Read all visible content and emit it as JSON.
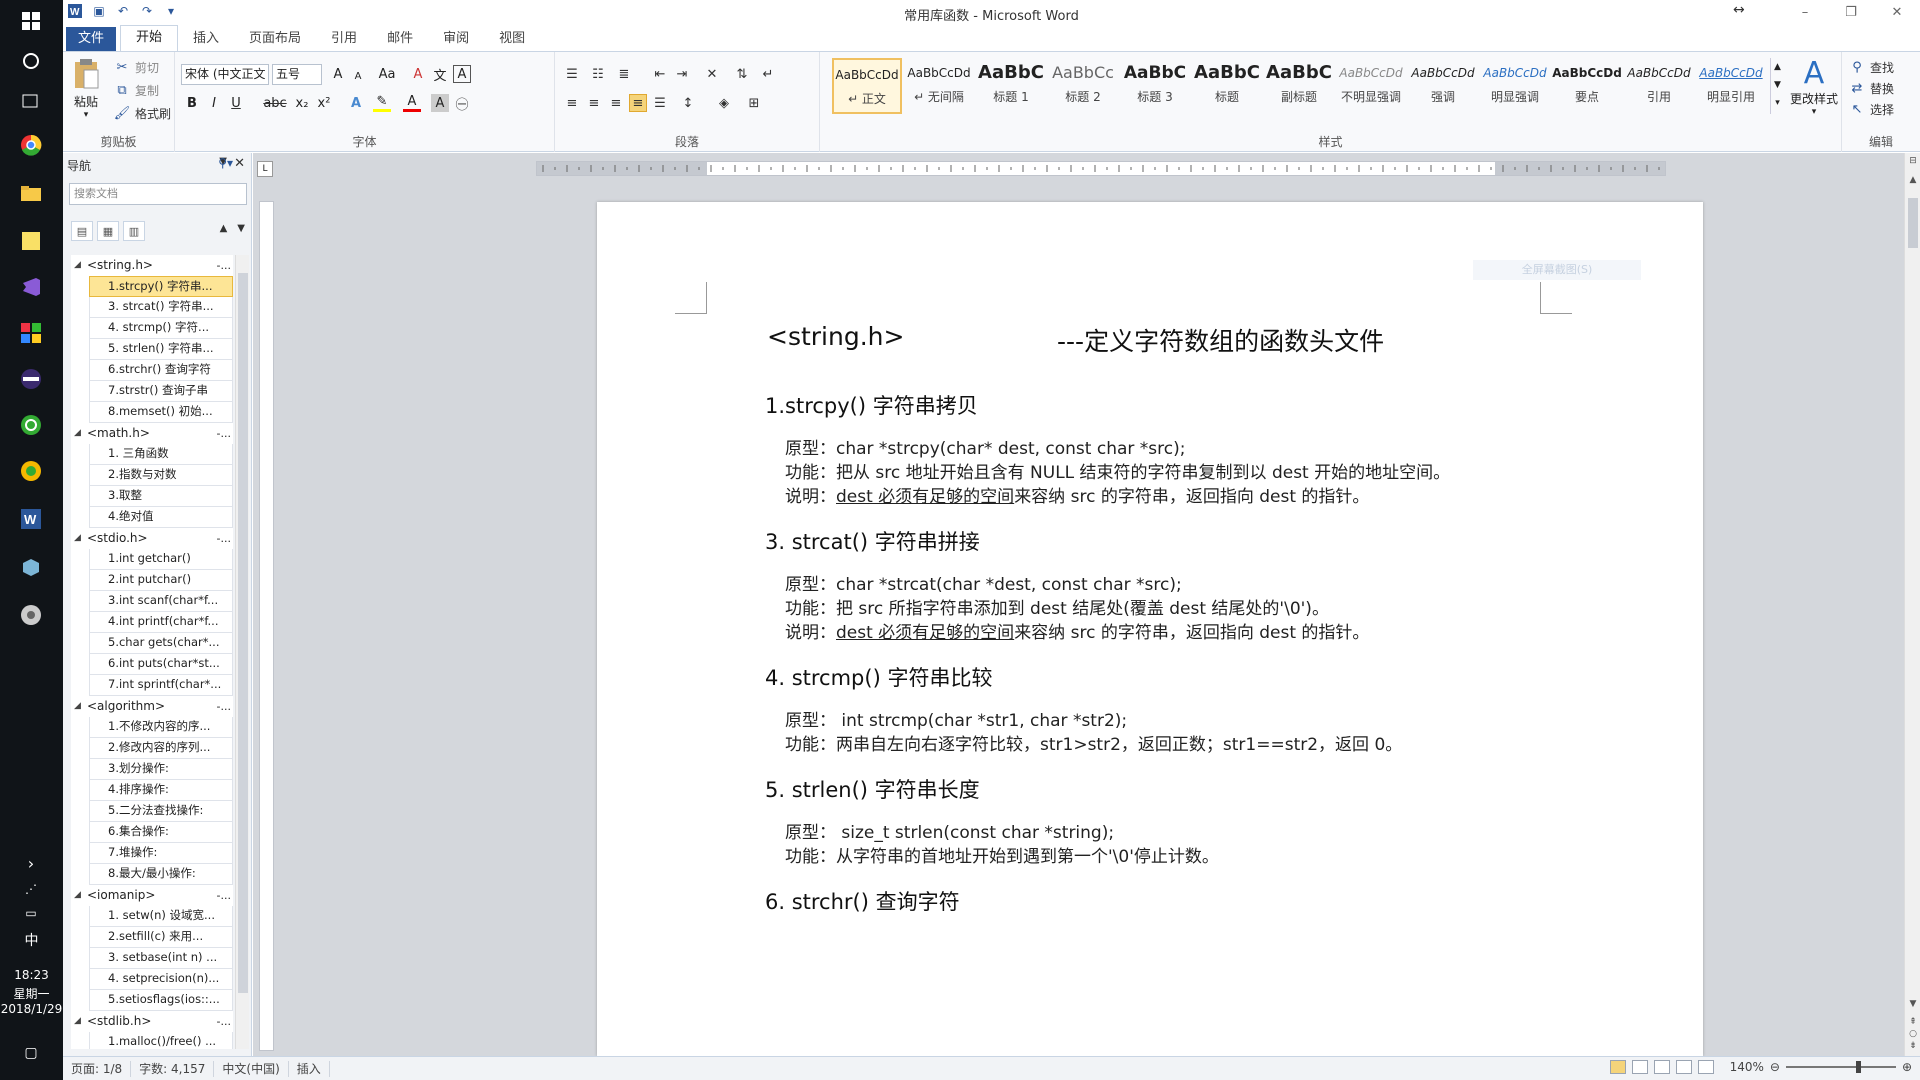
{
  "taskbar": {
    "time": "18:23",
    "weekday": "星期一",
    "date": "2018/1/29",
    "ime": "中"
  },
  "titlebar": {
    "title": "常用库函数 - Microsoft Word",
    "resize_glyph": "↔"
  },
  "tabs": [
    "文件",
    "开始",
    "插入",
    "页面布局",
    "引用",
    "邮件",
    "审阅",
    "视图"
  ],
  "ribbon": {
    "clipboard": {
      "paste": "粘贴",
      "cut": "剪切",
      "copy": "复制",
      "format_painter": "格式刷",
      "label": "剪贴板"
    },
    "font": {
      "name": "宋体 (中文正文",
      "size": "五号",
      "label": "字体",
      "bold": "B",
      "italic": "I",
      "underline": "U",
      "strike": "abc",
      "sub": "x₂",
      "sup": "x²",
      "grow": "A",
      "shrink": "A",
      "case": "Aa",
      "clear": "A",
      "phonetic": "文",
      "border": "A"
    },
    "paragraph": {
      "label": "段落"
    },
    "styles": {
      "label": "样式",
      "items": [
        {
          "preview": "AaBbCcDd",
          "name": "↵ 正文"
        },
        {
          "preview": "AaBbCcDd",
          "name": "↵ 无间隔"
        },
        {
          "preview": "AaBbC",
          "name": "标题 1"
        },
        {
          "preview": "AaBbCc",
          "name": "标题 2"
        },
        {
          "preview": "AaBbC",
          "name": "标题 3"
        },
        {
          "preview": "AaBbC",
          "name": "标题"
        },
        {
          "preview": "AaBbC",
          "name": "副标题"
        },
        {
          "preview": "AaBbCcDd",
          "name": "不明显强调"
        },
        {
          "preview": "AaBbCcDd",
          "name": "强调"
        },
        {
          "preview": "AaBbCcDd",
          "name": "明显强调"
        },
        {
          "preview": "AaBbCcDd",
          "name": "要点"
        },
        {
          "preview": "AaBbCcDd",
          "name": "引用"
        },
        {
          "preview": "AaBbCcDd",
          "name": "明显引用"
        }
      ],
      "change": "更改样式"
    },
    "editing": {
      "find": "查找",
      "replace": "替换",
      "select": "选择",
      "label": "编辑"
    }
  },
  "nav": {
    "title": "导航",
    "search_placeholder": "搜索文档",
    "tree": [
      {
        "type": "h1",
        "text": "<string.h>",
        "dash": "-..."
      },
      {
        "type": "h2",
        "text": "1.strcpy()  字符串...",
        "active": true
      },
      {
        "type": "h2",
        "text": "3. strcat() 字符串..."
      },
      {
        "type": "h2",
        "text": "4. strcmp() 字符..."
      },
      {
        "type": "h2",
        "text": "5. strlen() 字符串..."
      },
      {
        "type": "h2",
        "text": "6.strchr() 查询字符"
      },
      {
        "type": "h2",
        "text": "7.strstr() 查询子串"
      },
      {
        "type": "h2",
        "text": "8.memset() 初始..."
      },
      {
        "type": "h1",
        "text": "<math.h>",
        "dash": "-..."
      },
      {
        "type": "h2",
        "text": "1. 三角函数"
      },
      {
        "type": "h2",
        "text": "2.指数与对数"
      },
      {
        "type": "h2",
        "text": "3.取整"
      },
      {
        "type": "h2",
        "text": "4.绝对值"
      },
      {
        "type": "h1",
        "text": "<stdio.h>",
        "dash": "-..."
      },
      {
        "type": "h2",
        "text": "1.int getchar()"
      },
      {
        "type": "h2",
        "text": "2.int putchar()"
      },
      {
        "type": "h2",
        "text": "3.int scanf(char*f..."
      },
      {
        "type": "h2",
        "text": "4.int printf(char*f..."
      },
      {
        "type": "h2",
        "text": "5.char gets(char*..."
      },
      {
        "type": "h2",
        "text": "6.int puts(char*st..."
      },
      {
        "type": "h2",
        "text": "7.int sprintf(char*..."
      },
      {
        "type": "h1",
        "text": "<algorithm>",
        "dash": "-..."
      },
      {
        "type": "h2",
        "text": "1.不修改内容的序..."
      },
      {
        "type": "h2",
        "text": "2.修改内容的序列..."
      },
      {
        "type": "h2",
        "text": "3.划分操作:"
      },
      {
        "type": "h2",
        "text": "4.排序操作:"
      },
      {
        "type": "h2",
        "text": "5.二分法查找操作:"
      },
      {
        "type": "h2",
        "text": "6.集合操作:"
      },
      {
        "type": "h2",
        "text": "7.堆操作:"
      },
      {
        "type": "h2",
        "text": "8.最大/最小操作:"
      },
      {
        "type": "h1",
        "text": "<iomanip>",
        "dash": "-..."
      },
      {
        "type": "h2",
        "text": "1. setw(n)  设域宽..."
      },
      {
        "type": "h2",
        "text": "2.setfill(c)  来用..."
      },
      {
        "type": "h2",
        "text": "3. setbase(int n) ..."
      },
      {
        "type": "h2",
        "text": "4. setprecision(n)..."
      },
      {
        "type": "h2",
        "text": "5.setiosflags(ios::..."
      },
      {
        "type": "h1",
        "text": "<stdlib.h>",
        "dash": "-..."
      },
      {
        "type": "h2",
        "text": "1.malloc()/free() ..."
      }
    ]
  },
  "document": {
    "watermark": "全屏幕截图(S)",
    "title_left": "<string.h>",
    "title_right": "---定义字符数组的函数头文件",
    "sections": [
      {
        "heading": "1.strcpy()   字符串拷贝",
        "lines": [
          {
            "label": "原型：",
            "text": "char *strcpy(char* dest, const char *src);"
          },
          {
            "label": "功能：",
            "text": "把从 src 地址开始且含有 NULL 结束符的字符串复制到以 dest 开始的地址空间。"
          },
          {
            "label": "说明：",
            "underline": "dest 必须有足够的空间",
            "text": "来容纳 src 的字符串，返回指向 dest 的指针。"
          }
        ]
      },
      {
        "heading": "3. strcat() 字符串拼接",
        "lines": [
          {
            "label": "原型：",
            "text": "char *strcat(char *dest, const char *src);"
          },
          {
            "label": "功能：",
            "text": "把 src 所指字符串添加到 dest 结尾处(覆盖 dest 结尾处的'\\0')。"
          },
          {
            "label": "说明：",
            "underline": "dest 必须有足够的空间",
            "text": "来容纳 src 的字符串，返回指向 dest 的指针。"
          }
        ]
      },
      {
        "heading": "4. strcmp() 字符串比较",
        "lines": [
          {
            "label": "原型：",
            "text": " int strcmp(char *str1, char *str2);"
          },
          {
            "label": "功能：",
            "text": "两串自左向右逐字符比较，str1>str2，返回正数；str1==str2，返回 0。"
          }
        ]
      },
      {
        "heading": "5. strlen() 字符串长度",
        "lines": [
          {
            "label": "原型：",
            "text": " size_t strlen(const char *string);"
          },
          {
            "label": "功能：",
            "text": "从字符串的首地址开始到遇到第一个'\\0'停止计数。"
          }
        ]
      },
      {
        "heading": "6. strchr() 查询字符",
        "lines": []
      }
    ]
  },
  "statusbar": {
    "page": "页面: 1/8",
    "words": "字数: 4,157",
    "lang": "中文(中国)",
    "mode": "插入",
    "zoom": "140%"
  }
}
